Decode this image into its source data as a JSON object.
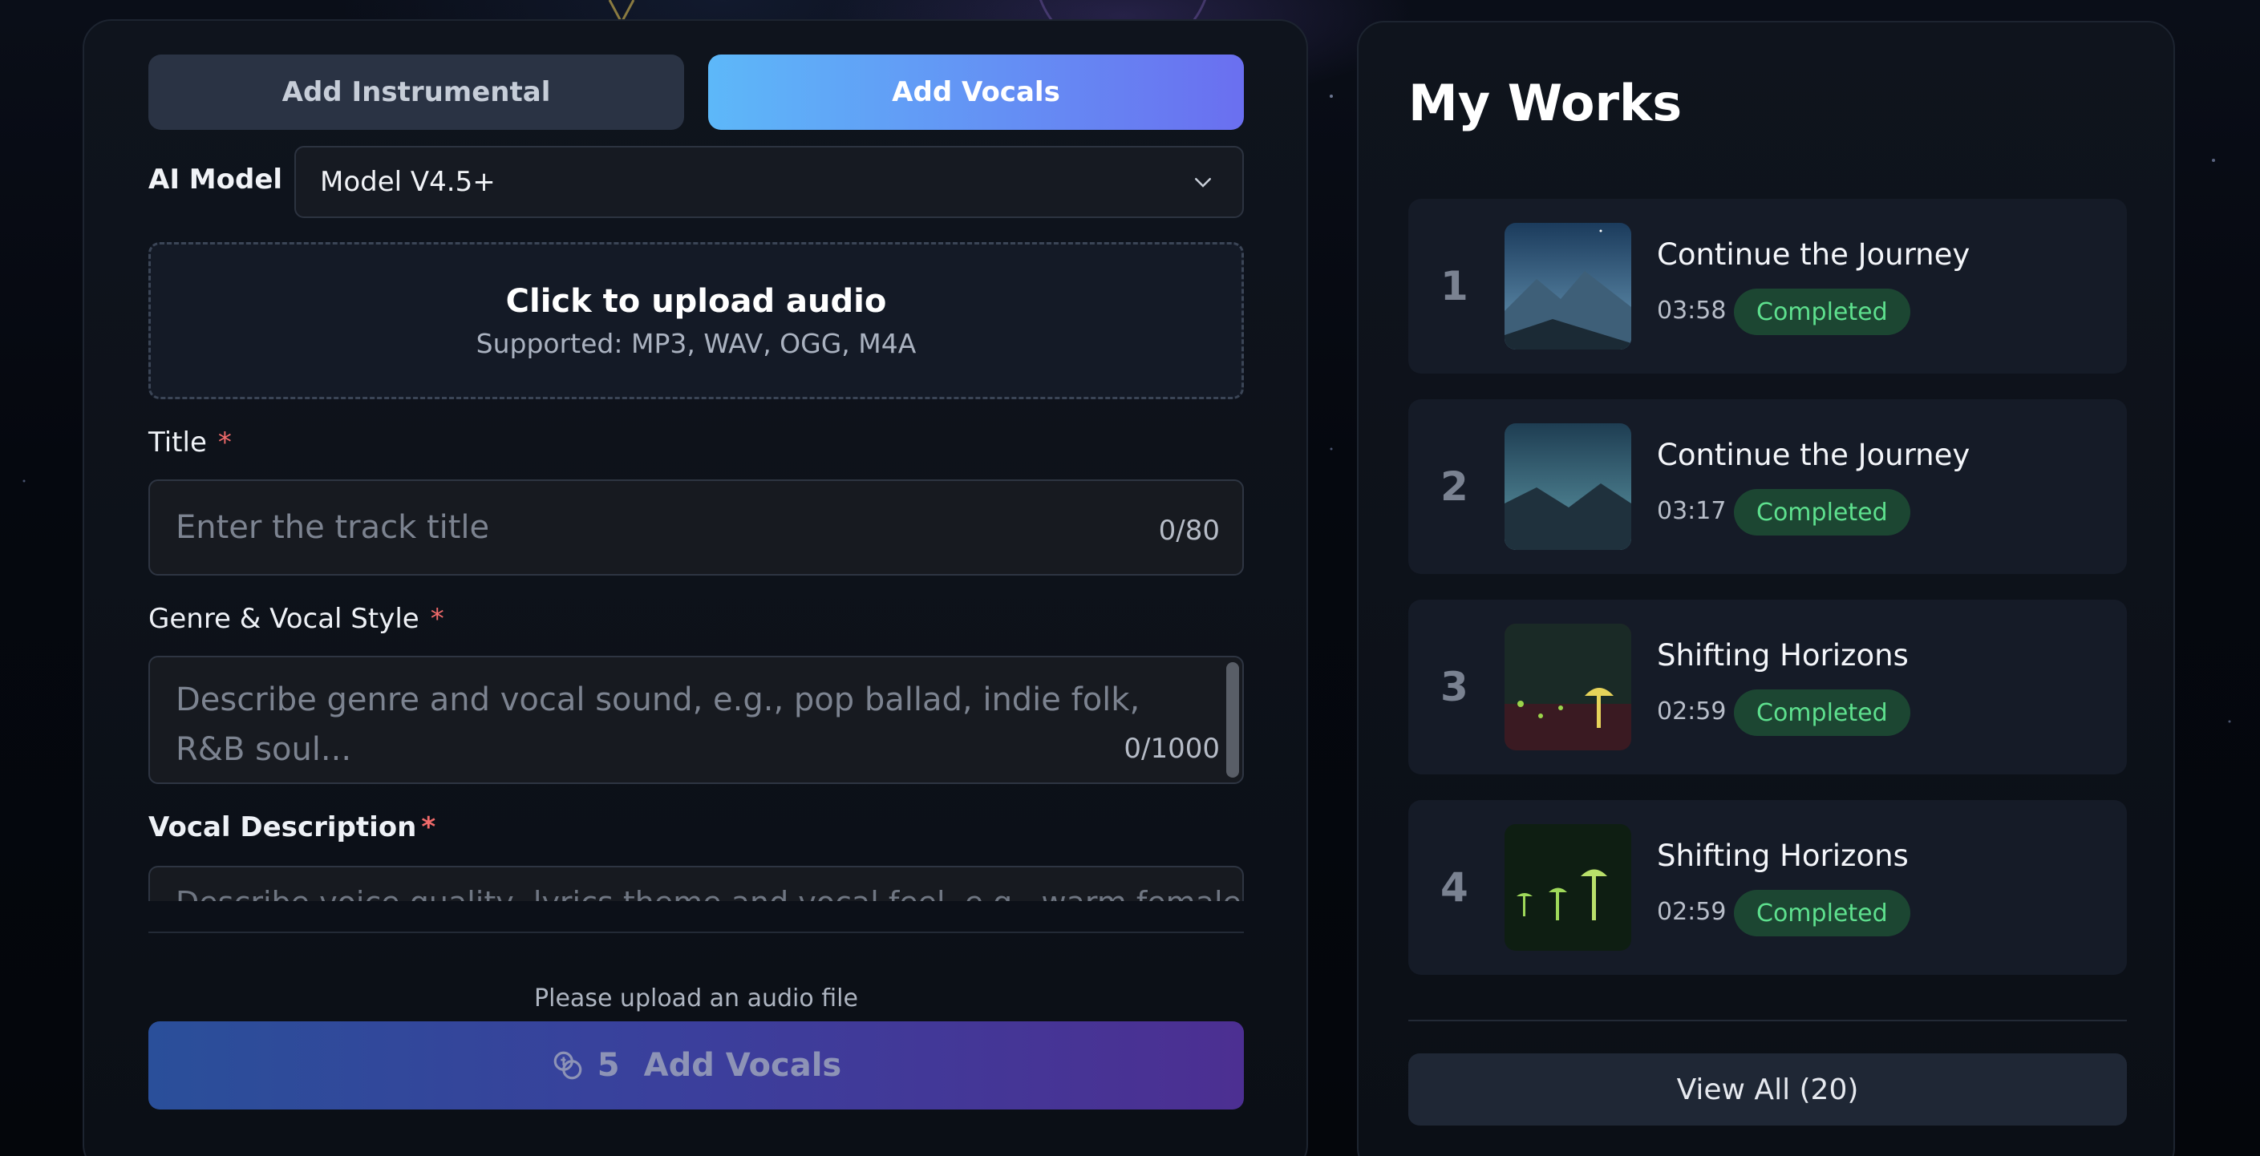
{
  "tabs": {
    "instrumental": "Add Instrumental",
    "vocals": "Add Vocals"
  },
  "ai_model": {
    "label": "AI Model",
    "selected": "Model V4.5+"
  },
  "upload": {
    "title": "Click to upload audio",
    "supported": "Supported: MP3, WAV, OGG, M4A"
  },
  "title_field": {
    "label": "Title",
    "required": "*",
    "placeholder": "Enter the track title",
    "counter": "0/80"
  },
  "genre_field": {
    "label": "Genre & Vocal Style",
    "required": "*",
    "placeholder": "Describe genre and vocal sound, e.g., pop ballad, indie folk, R&B soul...",
    "counter": "0/1000"
  },
  "vocal_desc": {
    "label": "Vocal Description",
    "required": "*",
    "placeholder": "Describe voice quality, lyrics theme and vocal feel, e.g., warm female voice"
  },
  "hint": "Please upload an audio file",
  "submit": {
    "credits": "5",
    "label": "Add Vocals"
  },
  "works": {
    "title": "My Works",
    "items": [
      {
        "index": "1",
        "name": "Continue the Journey",
        "duration": "03:58",
        "status": "Completed"
      },
      {
        "index": "2",
        "name": "Continue the Journey",
        "duration": "03:17",
        "status": "Completed"
      },
      {
        "index": "3",
        "name": "Shifting Horizons",
        "duration": "02:59",
        "status": "Completed"
      },
      {
        "index": "4",
        "name": "Shifting Horizons",
        "duration": "02:59",
        "status": "Completed"
      }
    ],
    "view_all": "View All (20)"
  },
  "colors": {
    "accent_gradient_start": "#5db8f9",
    "accent_gradient_end": "#6a6ff0",
    "status_green": "#5ee08e",
    "required_red": "#f06a6a"
  }
}
